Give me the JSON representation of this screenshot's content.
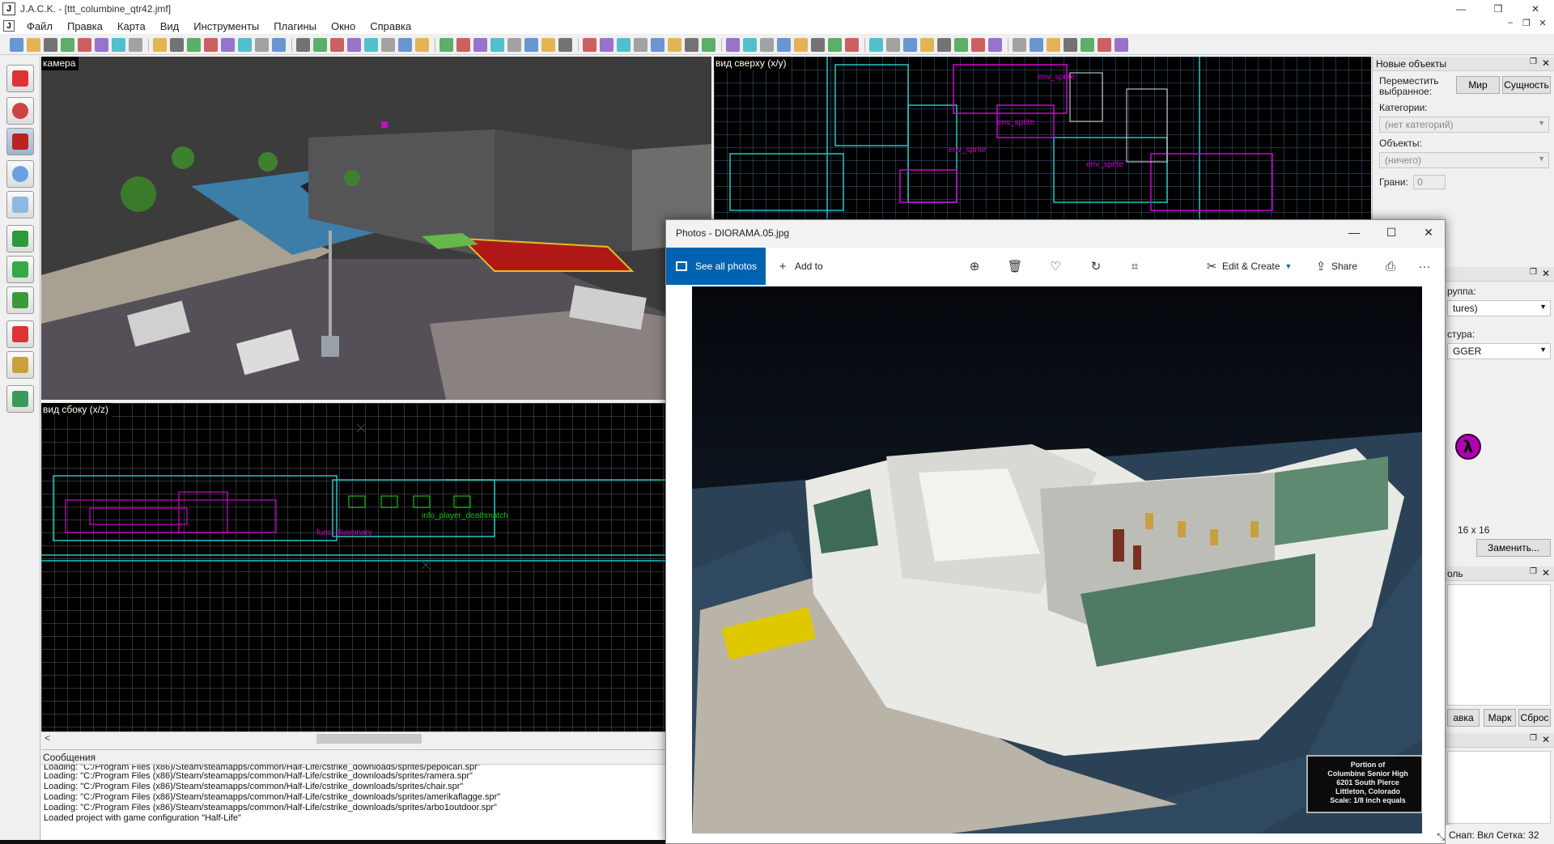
{
  "app": {
    "title": "J.A.C.K. - [ttt_columbine_qtr42.jmf]",
    "icon_letter": "J",
    "window_buttons": [
      "—",
      "❐",
      "✕"
    ],
    "mdi_buttons": [
      "–",
      "❐",
      "✕"
    ]
  },
  "menu": {
    "items": [
      "Файл",
      "Правка",
      "Карта",
      "Вид",
      "Инструменты",
      "Плагины",
      "Окно",
      "Справка"
    ]
  },
  "viewports": {
    "camera_label": "камера",
    "top_label": "вид сверху (x/y)",
    "side_label": "вид сбоку (x/z)",
    "top_entities": [
      "env_sprite",
      "env_sprite",
      "env_sprite",
      "env_sprite"
    ],
    "side_entities": [
      "func_illusionary",
      "info_player_deathmatch"
    ]
  },
  "messages": {
    "header": "Сообщения",
    "lines": [
      "Loading: \"C:/Program Files (x86)/Steam/steamapps/common/Half-Life/cstrike_downloads/sprites/pepolcan.spr\"",
      "Loading: \"C:/Program Files (x86)/Steam/steamapps/common/Half-Life/cstrike_downloads/sprites/ramera.spr\"",
      "Loading: \"C:/Program Files (x86)/Steam/steamapps/common/Half-Life/cstrike_downloads/sprites/chair.spr\"",
      "Loading: \"C:/Program Files (x86)/Steam/steamapps/common/Half-Life/cstrike_downloads/sprites/amerikaflagge.spr\"",
      "Loading: \"C:/Program Files (x86)/Steam/steamapps/common/Half-Life/cstrike_downloads/sprites/arbo1outdoor.spr\"",
      "Loaded project with game configuration \"Half-Life\""
    ]
  },
  "right_panel": {
    "new_objects_title": "Новые объекты",
    "move_selected_label": "Переместить выбранное:",
    "world_button": "Мир",
    "entity_button": "Сущность",
    "categories_label": "Категории:",
    "categories_value": "(нет категорий)",
    "objects_label": "Объекты:",
    "objects_value": "(ничего)",
    "faces_label": "Грани:",
    "faces_value": "0",
    "group_label": "руппа:",
    "group_value": "tures)",
    "texture_label": "стура:",
    "texture_value": "GGER",
    "texture_size": "16 x 16",
    "replace_button": "Заменить...",
    "third_title": "оль",
    "btn_mark_partial": "авка",
    "btn_mark": "Марк",
    "btn_reset": "Сброс"
  },
  "photos": {
    "title": "Photos - DIORAMA.05.jpg",
    "see_all": "See all photos",
    "add_to": "Add to",
    "edit_create": "Edit & Create",
    "share": "Share",
    "more": "···",
    "caption_lines": [
      "Portion of",
      "Columbine Senior High",
      "6201 South Pierce",
      "Littleton, Colorado",
      "Scale: 1/8 inch equals"
    ]
  },
  "status": {
    "text": "Снап: Вкл Сетка: 32"
  },
  "colors": {
    "accent_blue": "#0063b1",
    "viewport_bg": "#000000",
    "entity_magenta": "#d000d0",
    "brush_cyan": "#1bd1d1",
    "camera_label_bg": "#000000",
    "half_life_logo": "#b000b0"
  }
}
